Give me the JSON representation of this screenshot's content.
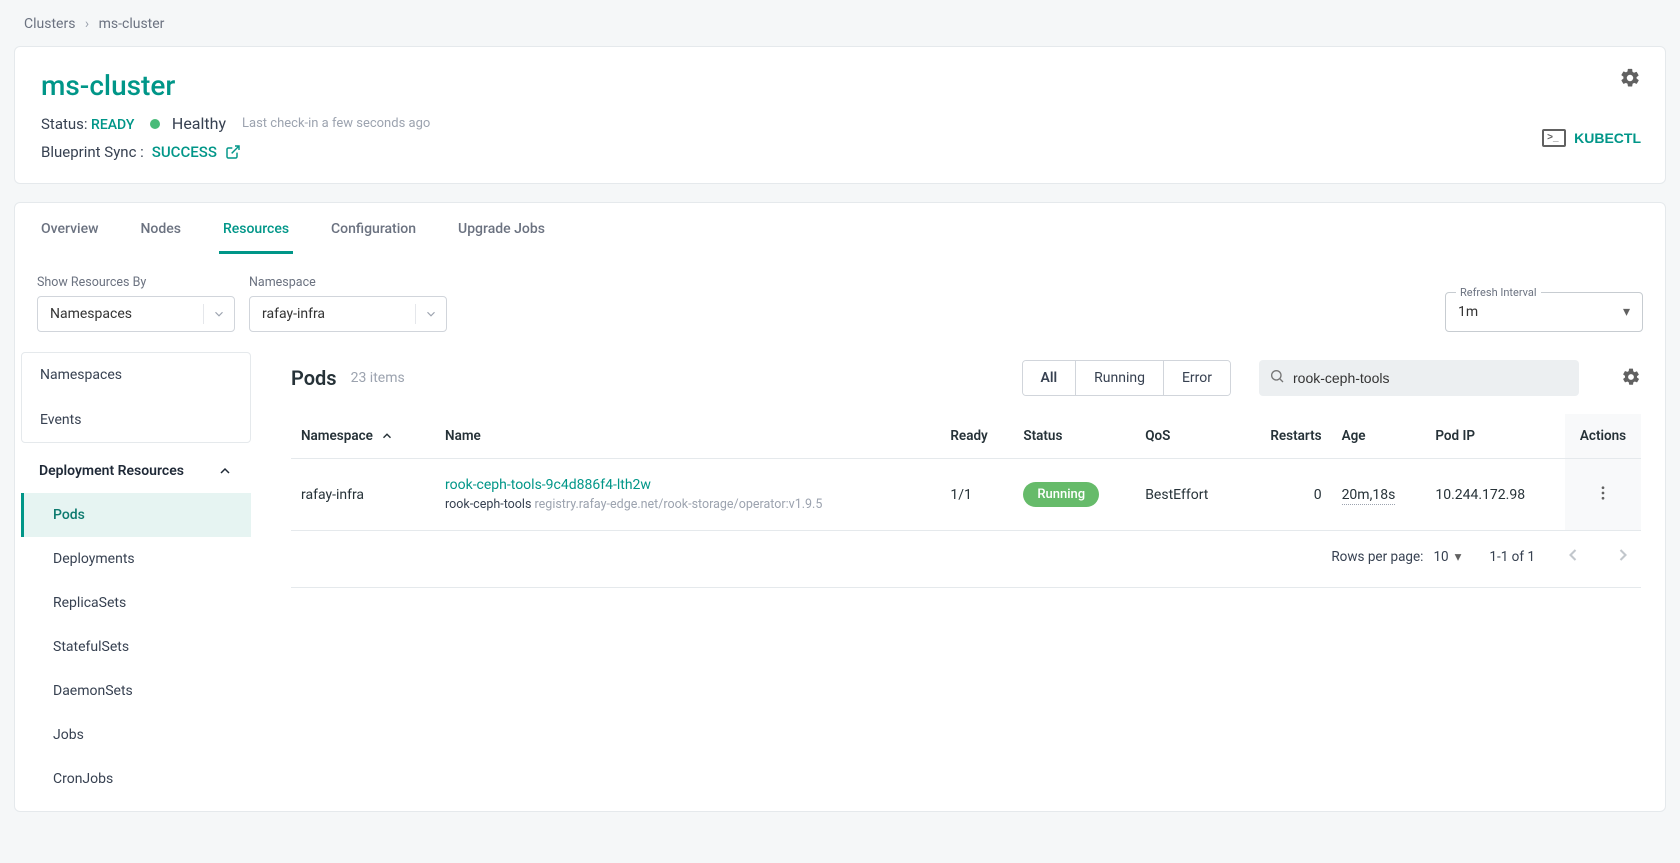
{
  "breadcrumb": {
    "parent": "Clusters",
    "current": "ms-cluster"
  },
  "header": {
    "title": "ms-cluster",
    "status_label": "Status:",
    "status_value": "READY",
    "healthy": "Healthy",
    "checkin": "Last check-in a few seconds ago",
    "bp_label": "Blueprint Sync :",
    "bp_value": "SUCCESS",
    "kubectl": "KUBECTL"
  },
  "tabs": [
    "Overview",
    "Nodes",
    "Resources",
    "Configuration",
    "Upgrade Jobs"
  ],
  "active_tab": "Resources",
  "filters": {
    "show_by_label": "Show Resources By",
    "show_by_value": "Namespaces",
    "namespace_label": "Namespace",
    "namespace_value": "rafay-infra",
    "refresh_label": "Refresh Interval",
    "refresh_value": "1m"
  },
  "sidebar": {
    "top": [
      "Namespaces",
      "Events"
    ],
    "category": "Deployment Resources",
    "items": [
      "Pods",
      "Deployments",
      "ReplicaSets",
      "StatefulSets",
      "DaemonSets",
      "Jobs",
      "CronJobs"
    ],
    "active": "Pods"
  },
  "panel": {
    "title": "Pods",
    "count": "23 items",
    "segments": [
      "All",
      "Running",
      "Error"
    ],
    "active_segment": "All",
    "search_value": "rook-ceph-tools"
  },
  "columns": [
    "Namespace",
    "Name",
    "Ready",
    "Status",
    "QoS",
    "Restarts",
    "Age",
    "Pod IP",
    "Actions"
  ],
  "rows": [
    {
      "namespace": "rafay-infra",
      "name": "rook-ceph-tools-9c4d886f4-lth2w",
      "container": "rook-ceph-tools",
      "image": "registry.rafay-edge.net/rook-storage/operator:v1.9.5",
      "ready": "1/1",
      "status": "Running",
      "qos": "BestEffort",
      "restarts": "0",
      "age": "20m,18s",
      "pod_ip": "10.244.172.98"
    }
  ],
  "footer": {
    "rpp_label": "Rows per page:",
    "rpp_value": "10",
    "range": "1-1 of 1"
  }
}
